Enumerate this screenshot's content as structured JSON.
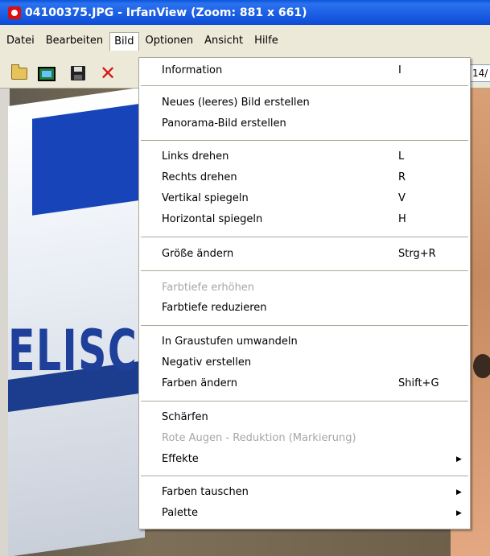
{
  "title": "04100375.JPG - IrfanView (Zoom: 881 x 661)",
  "menubar": [
    "Datei",
    "Bearbeiten",
    "Bild",
    "Optionen",
    "Ansicht",
    "Hilfe"
  ],
  "active_menu": "Bild",
  "toolbar": {
    "zoom_field": "14/"
  },
  "image": {
    "flag_text": "ELISC"
  },
  "menu": {
    "items": [
      {
        "label": "Information",
        "shortcut": "I"
      },
      {
        "label": "Neues (leeres) Bild erstellen"
      },
      {
        "label": "Panorama-Bild erstellen"
      },
      {
        "label": "Links drehen",
        "shortcut": "L"
      },
      {
        "label": "Rechts drehen",
        "shortcut": "R"
      },
      {
        "label": "Vertikal spiegeln",
        "shortcut": "V"
      },
      {
        "label": "Horizontal spiegeln",
        "shortcut": "H"
      },
      {
        "label": "Größe ändern",
        "shortcut": "Strg+R"
      },
      {
        "label": "Farbtiefe erhöhen",
        "disabled": true
      },
      {
        "label": "Farbtiefe reduzieren"
      },
      {
        "label": "In Graustufen umwandeln"
      },
      {
        "label": "Negativ erstellen"
      },
      {
        "label": "Farben ändern",
        "shortcut": "Shift+G"
      },
      {
        "label": "Schärfen"
      },
      {
        "label": "Rote Augen - Reduktion (Markierung)",
        "disabled": true
      },
      {
        "label": "Effekte",
        "submenu": true
      },
      {
        "label": "Farben tauschen",
        "submenu": true
      },
      {
        "label": "Palette",
        "submenu": true
      }
    ]
  },
  "colors": {
    "title_bar": "#1c5fe4",
    "menu_bg": "#ffffff",
    "disabled_text": "#a7a6aa"
  },
  "icons": [
    "open-folder-icon",
    "filmstrip-icon",
    "save-floppy-icon",
    "delete-x-icon",
    "submenu-arrow-icon"
  ]
}
